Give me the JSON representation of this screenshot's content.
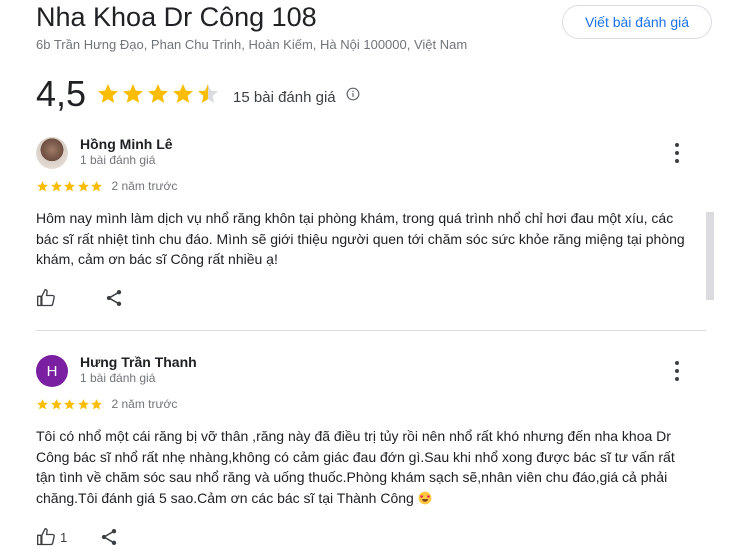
{
  "place": {
    "name": "Nha Khoa Dr Công 108",
    "address": "6b Trần Hưng Đạo, Phan Chu Trinh, Hoàn Kiếm, Hà Nội 100000, Việt Nam",
    "rating": "4,5",
    "rating_value": 4.5,
    "review_count_label": "15 bài đánh giá",
    "write_review_label": "Viết bài đánh giá"
  },
  "colors": {
    "star": "#fbbc04",
    "accent": "#1a73e8",
    "avatar_letter_bg": "#7b1fa2"
  },
  "reviews": [
    {
      "name": "Hồng Minh Lê",
      "meta": "1 bài đánh giá",
      "stars": 5,
      "time": "2 năm trước",
      "text": "Hôm nay mình làm dịch vụ nhổ răng khôn tại phòng khám, trong quá trình nhổ chỉ hơi đau một xíu, các bác sĩ rất nhiệt tình chu đáo. Mình sẽ giới thiệu người quen tới chăm sóc sức khỏe răng miệng tại phòng khám, cảm ơn bác sĩ Công rất nhiều ạ!",
      "avatar": "photo",
      "likes": ""
    },
    {
      "name": "Hưng Trần Thanh",
      "meta": "1 bài đánh giá",
      "stars": 5,
      "time": "2 năm trước",
      "text": "Tôi có nhổ một cái răng bị vỡ thân ,răng này đã điều trị tủy rồi nên nhổ rất khó nhưng đến nha khoa Dr Công bác sĩ nhổ rất nhẹ nhàng,không có cảm giác đau đớn gì.Sau khi nhổ xong được bác sĩ tư vấn rất tận tình về chăm sóc sau nhổ răng và uống thuốc.Phòng khám sạch sẽ,nhân viên chu đáo,giá cả phải chăng.Tôi đánh giá 5 sao.Cảm ơn các bác sĩ tại Thành Công",
      "avatar": "letter",
      "avatar_letter": "H",
      "likes": "1",
      "emoji": "smiling-face-with-heart-eyes"
    }
  ]
}
